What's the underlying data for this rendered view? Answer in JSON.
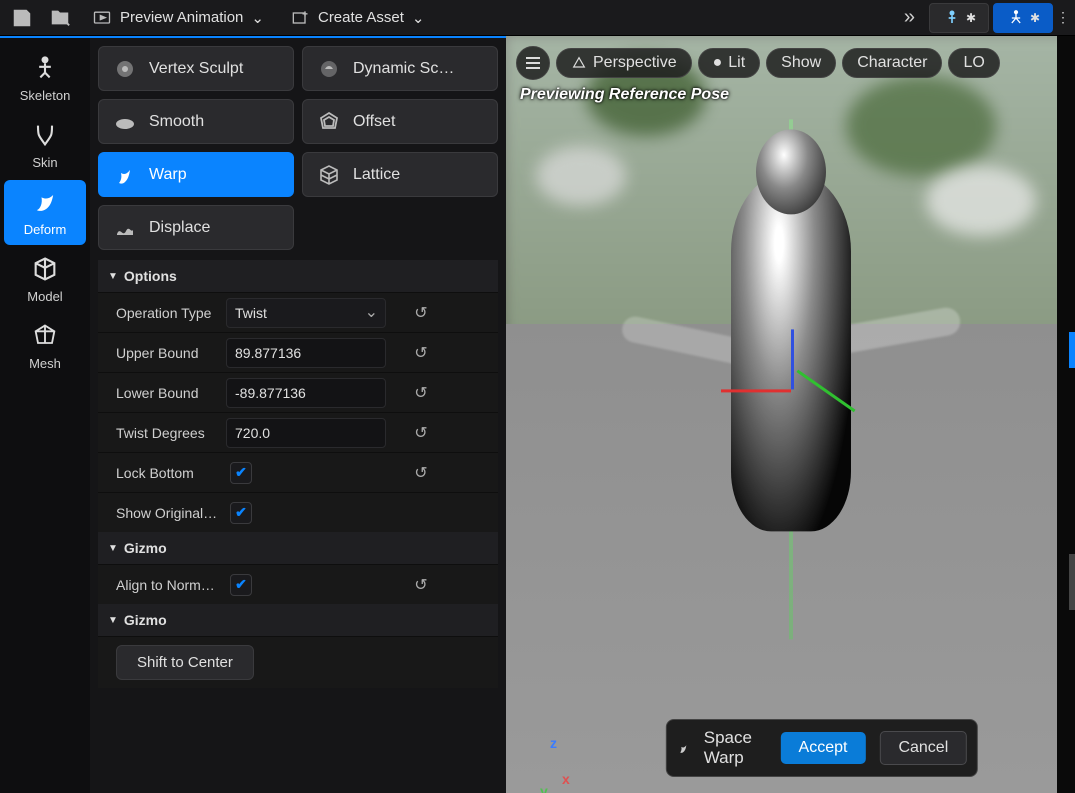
{
  "toolbar": {
    "preview_animation": "Preview Animation",
    "create_asset": "Create Asset"
  },
  "modes": {
    "skeleton": "Skeleton",
    "skin": "Skin",
    "deform": "Deform",
    "model": "Model",
    "mesh": "Mesh"
  },
  "tools": {
    "vertex_sculpt": "Vertex Sculpt",
    "dynamic_sculpt": "Dynamic Sc…",
    "smooth": "Smooth",
    "offset": "Offset",
    "warp": "Warp",
    "lattice": "Lattice",
    "displace": "Displace"
  },
  "sections": {
    "options": "Options",
    "gizmo1": "Gizmo",
    "gizmo2": "Gizmo"
  },
  "options": {
    "operation_type_label": "Operation Type",
    "operation_type_value": "Twist",
    "upper_bound_label": "Upper Bound",
    "upper_bound_value": "89.877136",
    "lower_bound_label": "Lower Bound",
    "lower_bound_value": "-89.877136",
    "twist_degrees_label": "Twist Degrees",
    "twist_degrees_value": "720.0",
    "lock_bottom_label": "Lock Bottom",
    "lock_bottom_checked": true,
    "show_original_label": "Show Original…",
    "show_original_checked": true
  },
  "gizmo": {
    "align_to_normal_label": "Align to Norm…",
    "align_to_normal_checked": true,
    "shift_to_center": "Shift to Center"
  },
  "viewport": {
    "perspective": "Perspective",
    "lit": "Lit",
    "show": "Show",
    "character": "Character",
    "lod": "LO",
    "status": "Previewing Reference Pose",
    "axes": {
      "x": "x",
      "y": "y",
      "z": "z"
    },
    "dialog_title": "Space Warp",
    "accept": "Accept",
    "cancel": "Cancel"
  }
}
